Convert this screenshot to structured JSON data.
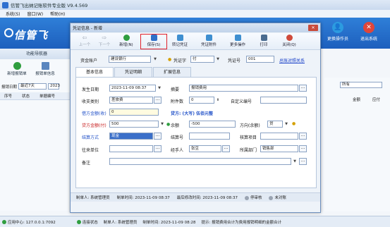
{
  "app": {
    "title": "信管飞出纳记账软件专业版 V9.4.569",
    "menu": [
      "系统(S)",
      "窗口(W)",
      "帮助(H)"
    ],
    "brand": "信管飞",
    "banner_buttons": [
      {
        "label": "更换操作员",
        "color": "#2c9be0"
      },
      {
        "label": "退出系统",
        "color": "#e0463a"
      }
    ]
  },
  "leftnav": {
    "header": "功能导航器",
    "tools": [
      "新增报销单",
      "报销单信息"
    ],
    "filter_label": "报销日期",
    "filter_value": "最近7天",
    "filter_date": "2023",
    "columns": [
      "序号",
      "状态",
      "单据编号"
    ]
  },
  "rightpanel": {
    "select_value": "所有",
    "columns": [
      "金额",
      "应付"
    ]
  },
  "statusbar": {
    "app_center": "应用中心: 127.0.0.1:7092",
    "connection": "连接状态",
    "operator": "制单人: 系统管理员",
    "created": "制单时间: 2023-11-09 08:28",
    "hint": "提示: 报销费用合计为费用报销明细的金额合计"
  },
  "dialog": {
    "title": "凭证信息 - 新增",
    "close": "✕",
    "toolbar": [
      {
        "label": "上一个",
        "disabled": true
      },
      {
        "label": "下一个",
        "disabled": true
      },
      {
        "label": "新增(N)",
        "disabled": false,
        "color": "#2f9e3f"
      },
      {
        "label": "保存(S)",
        "disabled": false,
        "color": "#2f6fc8"
      },
      {
        "label": "转记凭证",
        "disabled": false,
        "color": "#3f8fd0"
      },
      {
        "label": "凭证附件",
        "disabled": false,
        "color": "#3f8fd0"
      },
      {
        "label": "更多操作",
        "disabled": false,
        "color": "#3f8fd0"
      },
      {
        "label": "打印",
        "disabled": false,
        "color": "#4a6b8f"
      },
      {
        "label": "关闭(Q)",
        "disabled": false,
        "color": "#d04a3b"
      }
    ],
    "header_fields": {
      "account_label": "资金账户",
      "account_value": "建设银行",
      "voucher_type_label": "凭证字",
      "voucher_type_value": "付",
      "voucher_no_label": "凭证号",
      "voucher_no_value": "001",
      "link": "总账对照关系"
    },
    "tabs": [
      "基本信息",
      "凭证明细",
      "扩展信息"
    ],
    "form": {
      "date_label": "发生日期",
      "date_value": "2023-11-09 08:37",
      "summary_label": "摘要",
      "summary_value": "报销费用",
      "category_label": "收支类别",
      "category_value": "差旅费",
      "attachments_label": "附件数",
      "attachments_value": "0",
      "custom_no_label": "自定义编号",
      "custom_no_value": "",
      "debit_label": "借方金额(收)",
      "debit_value": "0",
      "amount_words": "贷方: (大写) 伍佰元整",
      "credit_label": "贷方金额(付)",
      "credit_value": "500",
      "balance_label": "余额",
      "balance_value": "-500",
      "direction_label": "方向(余额)",
      "direction_value": "贷",
      "settle_method_label": "结算方式",
      "settle_method_value": "现金",
      "settle_no_label": "结算号",
      "settle_no_value": "",
      "check_item_label": "核算项目",
      "check_item_value": "",
      "counterpart_label": "往来单位",
      "counterpart_value": "",
      "handler_label": "经手人",
      "handler_value": "张豆",
      "dept_label": "所属部门",
      "dept_value": "销售部",
      "remark_label": "备注",
      "remark_value": ""
    },
    "footer": {
      "operator": "制单人: 系统管理员",
      "created": "制单时间: 2023-11-09 08:37",
      "modified": "最后修改时间: 2023-11-09 08:37",
      "status_stop": "停审核",
      "status_unpost": "未对账"
    }
  }
}
